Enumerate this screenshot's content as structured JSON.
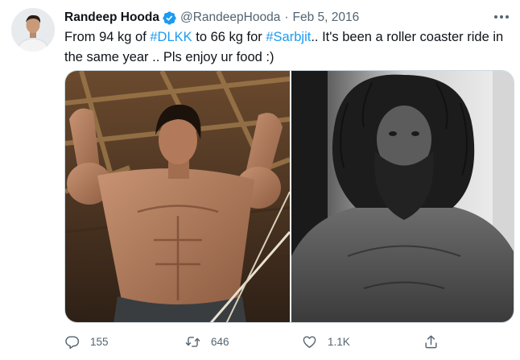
{
  "author": {
    "name": "Randeep Hooda",
    "handle": "@RandeepHooda",
    "separator": "·",
    "date": "Feb 5, 2016",
    "verified": true
  },
  "tweet": {
    "text_parts": [
      {
        "text": "From 94 kg of ",
        "hashtag": false
      },
      {
        "text": "#DLKK",
        "hashtag": true
      },
      {
        "text": " to 66 kg for ",
        "hashtag": false
      },
      {
        "text": "#Sarbjit",
        "hashtag": true
      },
      {
        "text": ".. It's been a roller coaster ride in the same year .. Pls enjoy ur food :)",
        "hashtag": false
      }
    ]
  },
  "media": [
    {
      "icon": "muscular-man-photo",
      "tone": "warm"
    },
    {
      "icon": "bearded-thin-man-photo",
      "tone": "monochrome"
    }
  ],
  "actions": {
    "reply": {
      "icon": "reply-icon",
      "count": "155"
    },
    "retweet": {
      "icon": "retweet-icon",
      "count": "646"
    },
    "like": {
      "icon": "heart-icon",
      "count": "1.1K"
    },
    "share": {
      "icon": "share-icon",
      "count": ""
    }
  },
  "colors": {
    "accent": "#1d9bf0",
    "text": "#0f1419",
    "secondary": "#536471",
    "border": "#cfd9de"
  }
}
